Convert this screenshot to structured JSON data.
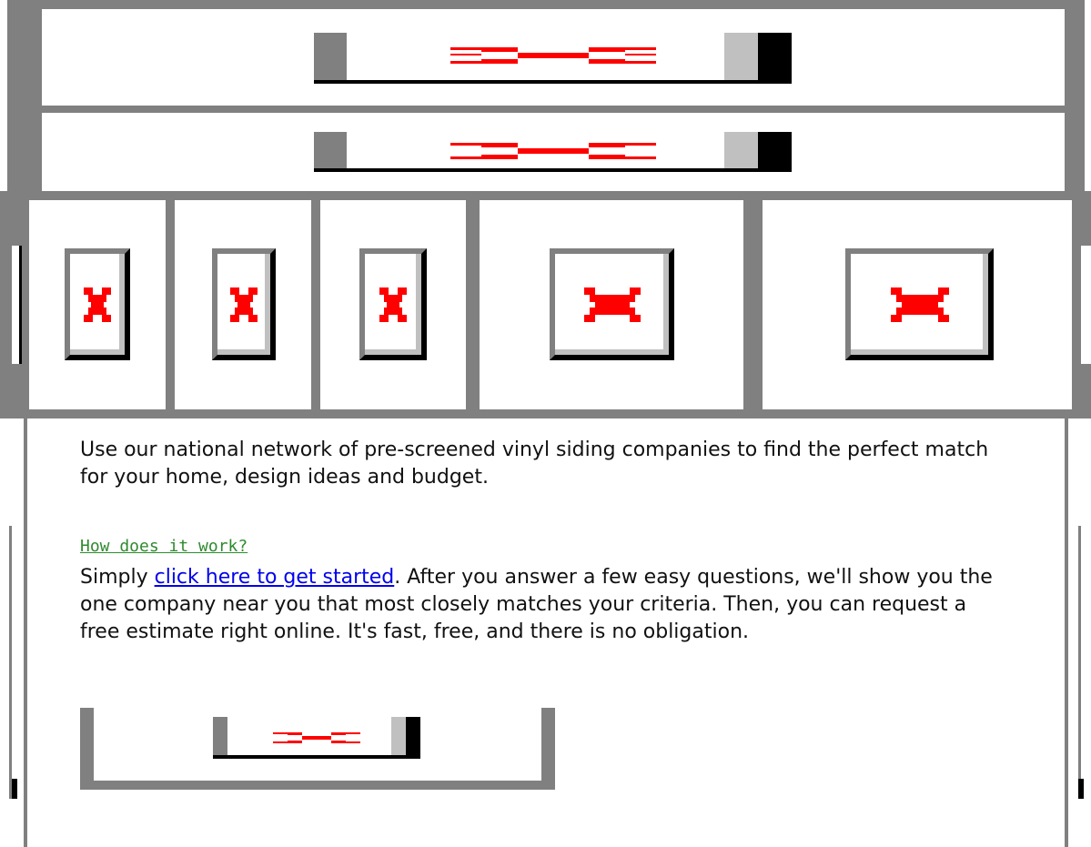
{
  "main": {
    "intro_text": "Use our national network of pre-screened vinyl siding companies to find the perfect match for your home, design ideas and budget.",
    "how_heading": "How does it work?",
    "how_text_before": "Simply ",
    "how_link": "click here to get started",
    "how_text_after": ". After you answer a few easy questions, we'll show you the one company near you that most closely matches your criteria. Then, you can request a free estimate right online. It's fast, free, and there is no obligation."
  },
  "images": {
    "top_banner_1": "broken-image-icon",
    "top_banner_2": "broken-image-icon",
    "nav_tiles": [
      "broken-image-icon",
      "broken-image-icon",
      "broken-image-icon",
      "broken-image-icon",
      "broken-image-icon"
    ],
    "cta_banner": "broken-image-icon"
  },
  "colors": {
    "frame_gray": "#808080",
    "broken_icon_red": "#ff0000",
    "heading_green": "#2e8b2e",
    "link_blue": "#0000ee"
  }
}
